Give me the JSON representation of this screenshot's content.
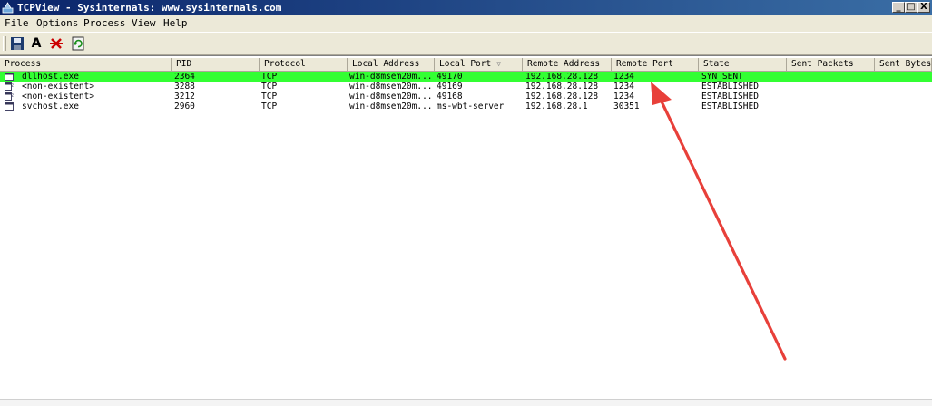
{
  "window": {
    "title": "TCPView - Sysinternals: www.sysinternals.com",
    "controls": {
      "minimize": "_",
      "maximize": "□",
      "close": "X"
    }
  },
  "menu": [
    "File",
    "Options",
    "Process",
    "View",
    "Help"
  ],
  "toolbar": {
    "icons": [
      "save-icon",
      "font-icon",
      "close-connection-icon",
      "refresh-icon"
    ],
    "font_glyph": "A"
  },
  "columns": [
    "Process",
    "PID",
    "Protocol",
    "Local Address",
    "Local Port",
    "Remote Address",
    "Remote Port",
    "State",
    "Sent Packets",
    "Sent Bytes"
  ],
  "sort_indicator": "▽",
  "rows": [
    {
      "process": "dllhost.exe",
      "pid": "2364",
      "protocol": "TCP",
      "local_address": "win-d8msem20m...",
      "local_port": "49170",
      "remote_address": "192.168.28.128",
      "remote_port": "1234",
      "state": "SYN_SENT",
      "selected": true
    },
    {
      "process": "<non-existent>",
      "pid": "3288",
      "protocol": "TCP",
      "local_address": "win-d8msem20m...",
      "local_port": "49169",
      "remote_address": "192.168.28.128",
      "remote_port": "1234",
      "state": "ESTABLISHED",
      "selected": false
    },
    {
      "process": "<non-existent>",
      "pid": "3212",
      "protocol": "TCP",
      "local_address": "win-d8msem20m...",
      "local_port": "49168",
      "remote_address": "192.168.28.128",
      "remote_port": "1234",
      "state": "ESTABLISHED",
      "selected": false
    },
    {
      "process": "svchost.exe",
      "pid": "2960",
      "protocol": "TCP",
      "local_address": "win-d8msem20m...",
      "local_port": "ms-wbt-server",
      "remote_address": "192.168.28.1",
      "remote_port": "30351",
      "state": "ESTABLISHED",
      "selected": false
    }
  ],
  "colors": {
    "selected_row": "#33ff33",
    "annotation_arrow": "#e8403a",
    "titlebar": "#0a246a"
  }
}
